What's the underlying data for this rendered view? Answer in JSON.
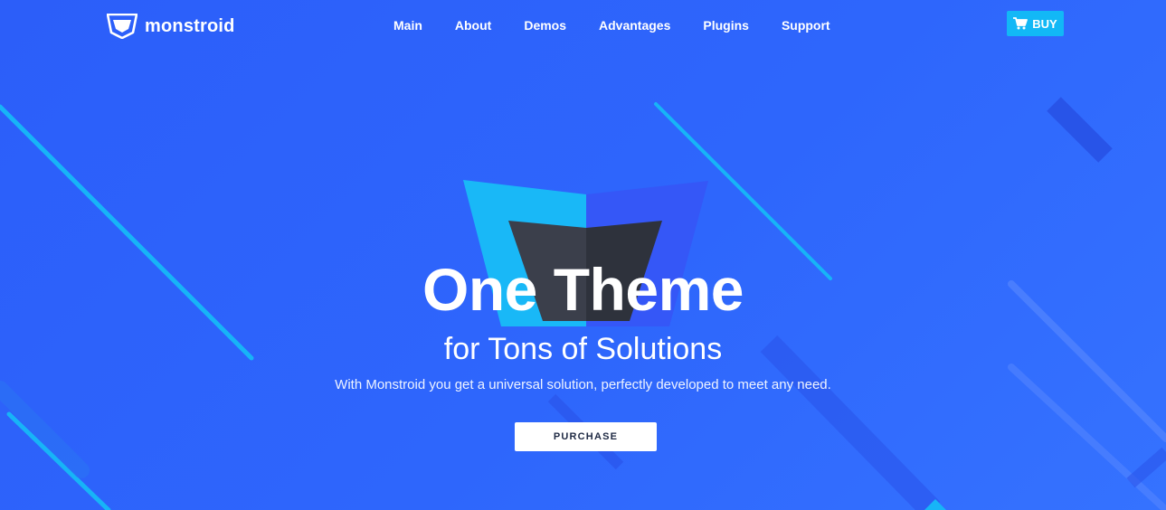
{
  "brand": {
    "name": "monstroid",
    "logo_icon": "shield-logo-icon"
  },
  "nav": {
    "items": [
      {
        "label": "Main"
      },
      {
        "label": "About"
      },
      {
        "label": "Demos"
      },
      {
        "label": "Advantages"
      },
      {
        "label": "Plugins"
      },
      {
        "label": "Support"
      }
    ]
  },
  "header": {
    "buy_label": "BUY",
    "buy_icon": "cart-icon"
  },
  "hero": {
    "title": "One Theme",
    "subtitle": "for Tons of Solutions",
    "description": "With Monstroid you get a universal solution, perfectly developed to meet any need.",
    "purchase_label": "PURCHASE"
  },
  "colors": {
    "background": "#2e63fb",
    "accent_cyan": "#12b8f6",
    "shield_dark": "#3a3e4a",
    "button_bg": "#ffffff"
  }
}
